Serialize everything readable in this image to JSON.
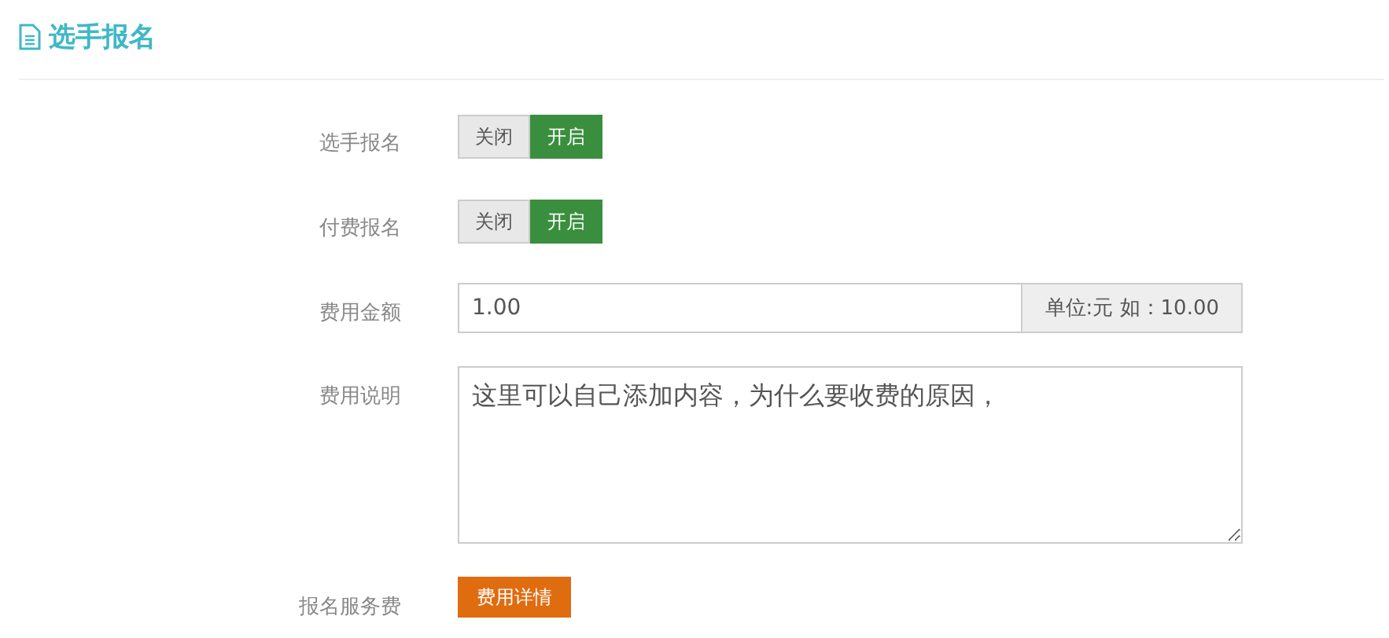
{
  "header": {
    "title": "选手报名"
  },
  "rows": [
    {
      "kind": "toggle",
      "label": "选手报名",
      "options": [
        {
          "label": "关闭",
          "selected": false
        },
        {
          "label": "开启",
          "selected": true
        }
      ]
    },
    {
      "kind": "toggle",
      "label": "付费报名",
      "options": [
        {
          "label": "关闭",
          "selected": false
        },
        {
          "label": "开启",
          "selected": true
        }
      ]
    },
    {
      "kind": "input",
      "label": "费用金额",
      "value": "1.00",
      "addon": "单位:元 如：10.00"
    },
    {
      "kind": "textarea",
      "label": "费用说明",
      "value": "这里可以自己添加内容，为什么要收费的原因，"
    },
    {
      "kind": "button",
      "label": "报名服务费",
      "button": "费用详情"
    }
  ]
}
